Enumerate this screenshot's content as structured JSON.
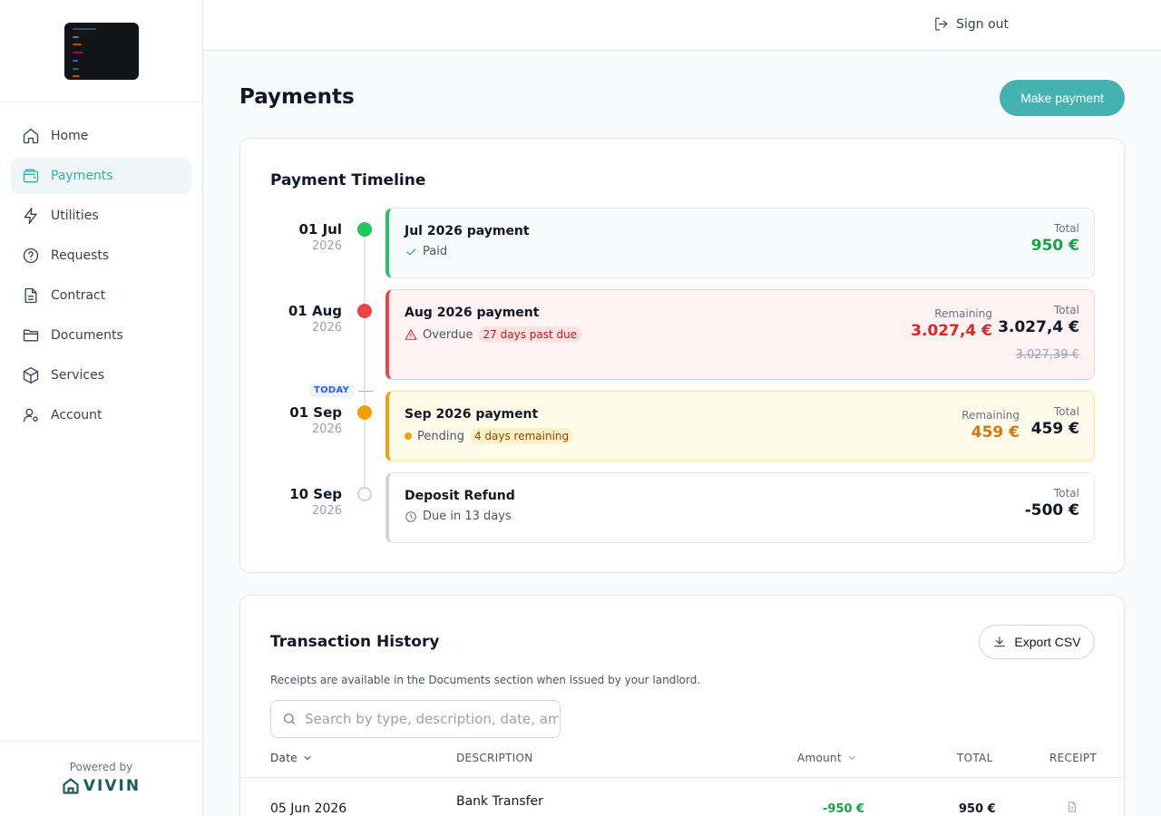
{
  "header": {
    "signout_label": "Sign out"
  },
  "sidebar": {
    "items": [
      {
        "label": "Home",
        "icon": "home-icon"
      },
      {
        "label": "Payments",
        "icon": "wallet-icon",
        "active": true
      },
      {
        "label": "Utilities",
        "icon": "lightning-icon"
      },
      {
        "label": "Requests",
        "icon": "question-circle-icon"
      },
      {
        "label": "Contract",
        "icon": "document-icon"
      },
      {
        "label": "Documents",
        "icon": "folder-icon"
      },
      {
        "label": "Services",
        "icon": "box-icon"
      },
      {
        "label": "Account",
        "icon": "user-settings-icon"
      }
    ],
    "powered_by": "Powered by",
    "brand": "VIVIN"
  },
  "page": {
    "title": "Payments",
    "make_payment_label": "Make payment"
  },
  "timeline": {
    "title": "Payment Timeline",
    "today_label": "TODAY",
    "entries": [
      {
        "day": "01 Jul",
        "year": "2026",
        "title": "Jul 2026 payment",
        "status": "Paid",
        "total_label": "Total",
        "total": "950 €"
      },
      {
        "day": "01 Aug",
        "year": "2026",
        "title": "Aug 2026 payment",
        "status": "Overdue",
        "badge": "27 days past due",
        "remaining_label": "Remaining",
        "remaining": "3.027,4 €",
        "total_label": "Total",
        "total": "3.027,4 €",
        "original": "3.027,39 €"
      },
      {
        "day": "01 Sep",
        "year": "2026",
        "title": "Sep 2026 payment",
        "status": "Pending",
        "badge": "4 days remaining",
        "remaining_label": "Remaining",
        "remaining": "459 €",
        "total_label": "Total",
        "total": "459 €"
      },
      {
        "day": "10 Sep",
        "year": "2026",
        "title": "Deposit Refund",
        "status": "Due in 13 days",
        "total_label": "Total",
        "total": "-500 €"
      }
    ]
  },
  "history": {
    "title": "Transaction History",
    "export_label": "Export CSV",
    "note": "Receipts are available in the Documents section when issued by your landlord.",
    "search_placeholder": "Search by type, description, date, amount",
    "columns": {
      "date": "Date",
      "description": "DESCRIPTION",
      "amount": "Amount",
      "total": "TOTAL",
      "receipt": "RECEIPT"
    },
    "rows": [
      {
        "date": "05 Jun 2026",
        "description": "Bank Transfer",
        "amount": "-950 €",
        "total": "950 €"
      }
    ]
  },
  "colors": {
    "accent": "#44b2b0",
    "paid": "#16a34a",
    "overdue": "#dc2626",
    "pending": "#f59e0b"
  }
}
